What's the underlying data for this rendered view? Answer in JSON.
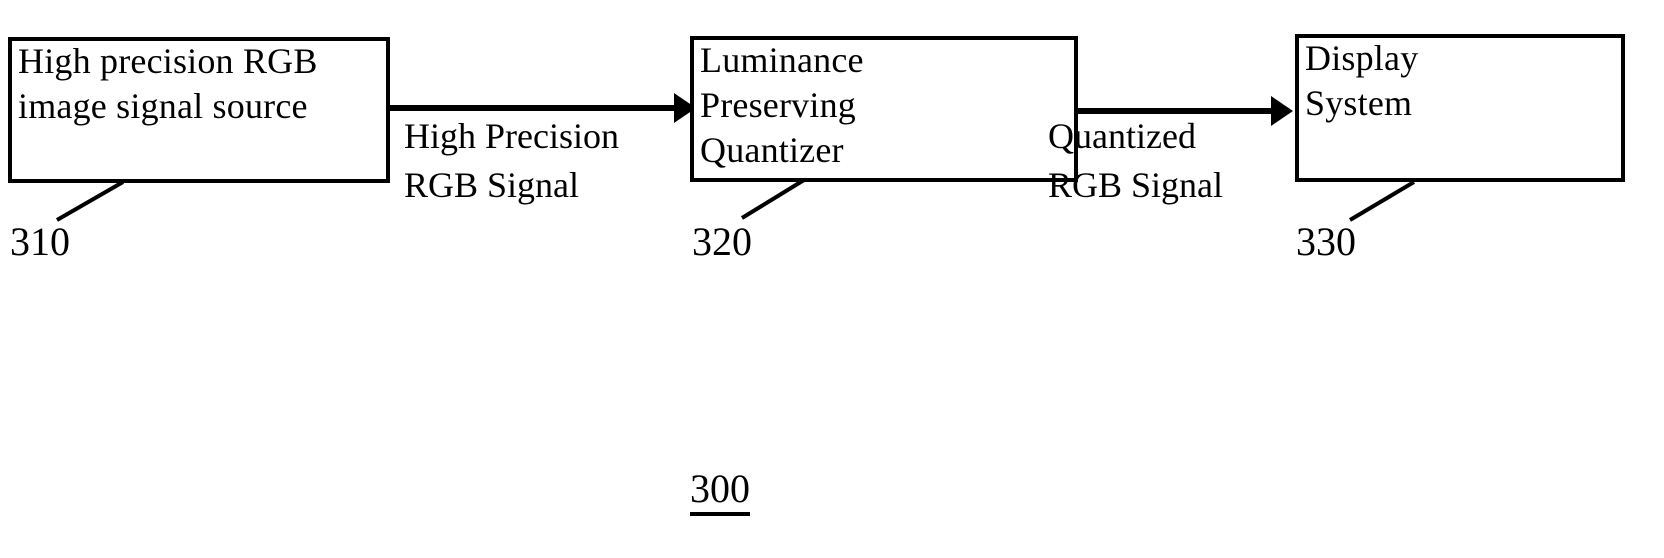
{
  "figure": {
    "number": "300",
    "type": "block-diagram"
  },
  "blocks": [
    {
      "id": "source",
      "label": "High precision RGB\nimage signal source",
      "ref": "310"
    },
    {
      "id": "quantizer",
      "label": "Luminance\nPreserving\nQuantizer",
      "ref": "320"
    },
    {
      "id": "display",
      "label": "Display\nSystem",
      "ref": "330"
    }
  ],
  "connections": [
    {
      "id": "signal-1",
      "from": "source",
      "to": "quantizer",
      "label": "High Precision\nRGB Signal"
    },
    {
      "id": "signal-2",
      "from": "quantizer",
      "to": "display",
      "label": "Quantized\nRGB Signal"
    }
  ],
  "colors": {
    "stroke": "#000000",
    "background": "#ffffff"
  }
}
